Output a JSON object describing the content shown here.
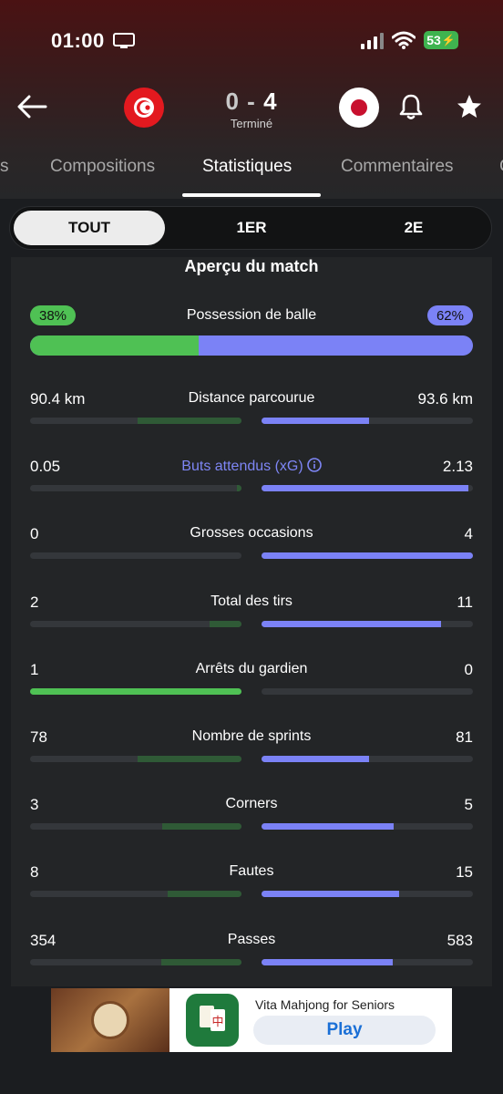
{
  "status_bar": {
    "time": "01:00",
    "battery": "53"
  },
  "match": {
    "score_home": "0",
    "score_sep": "-",
    "score_away": "4",
    "status": "Terminé"
  },
  "tabs": [
    {
      "label": "s"
    },
    {
      "label": "Compositions"
    },
    {
      "label": "Statistiques"
    },
    {
      "label": "Commentaires"
    },
    {
      "label": "C"
    }
  ],
  "periods": [
    "TOUT",
    "1ER",
    "2E"
  ],
  "section_title": "Aperçu du match",
  "possession": {
    "label": "Possession de balle",
    "home": "38%",
    "away": "62%",
    "home_fraction": 0.38
  },
  "stats": [
    {
      "label": "Distance parcourue",
      "home": "90.4 km",
      "away": "93.6 km",
      "home_fill": 0.49,
      "away_fill": 0.51,
      "link": false
    },
    {
      "label": "Buts attendus (xG)",
      "home": "0.05",
      "away": "2.13",
      "home_fill": 0.02,
      "away_fill": 0.98,
      "link": true
    },
    {
      "label": "Grosses occasions",
      "home": "0",
      "away": "4",
      "home_fill": 0,
      "away_fill": 1,
      "link": false
    },
    {
      "label": "Total des tirs",
      "home": "2",
      "away": "11",
      "home_fill": 0.15,
      "away_fill": 0.85,
      "link": false
    },
    {
      "label": "Arrêts du gardien",
      "home": "1",
      "away": "0",
      "home_fill": 1,
      "away_fill": 0,
      "link": false
    },
    {
      "label": "Nombre de sprints",
      "home": "78",
      "away": "81",
      "home_fill": 0.49,
      "away_fill": 0.51,
      "link": false
    },
    {
      "label": "Corners",
      "home": "3",
      "away": "5",
      "home_fill": 0.375,
      "away_fill": 0.625,
      "link": false
    },
    {
      "label": "Fautes",
      "home": "8",
      "away": "15",
      "home_fill": 0.35,
      "away_fill": 0.65,
      "link": false
    },
    {
      "label": "Passes",
      "home": "354",
      "away": "583",
      "home_fill": 0.38,
      "away_fill": 0.62,
      "link": false
    }
  ],
  "colors": {
    "home": "#4fc154",
    "home_dim": "#2f5a36",
    "away": "#7b82f6",
    "away_dim": "#454a7a"
  },
  "ad": {
    "title": "Vita Mahjong for Seniors",
    "cta": "Play"
  }
}
